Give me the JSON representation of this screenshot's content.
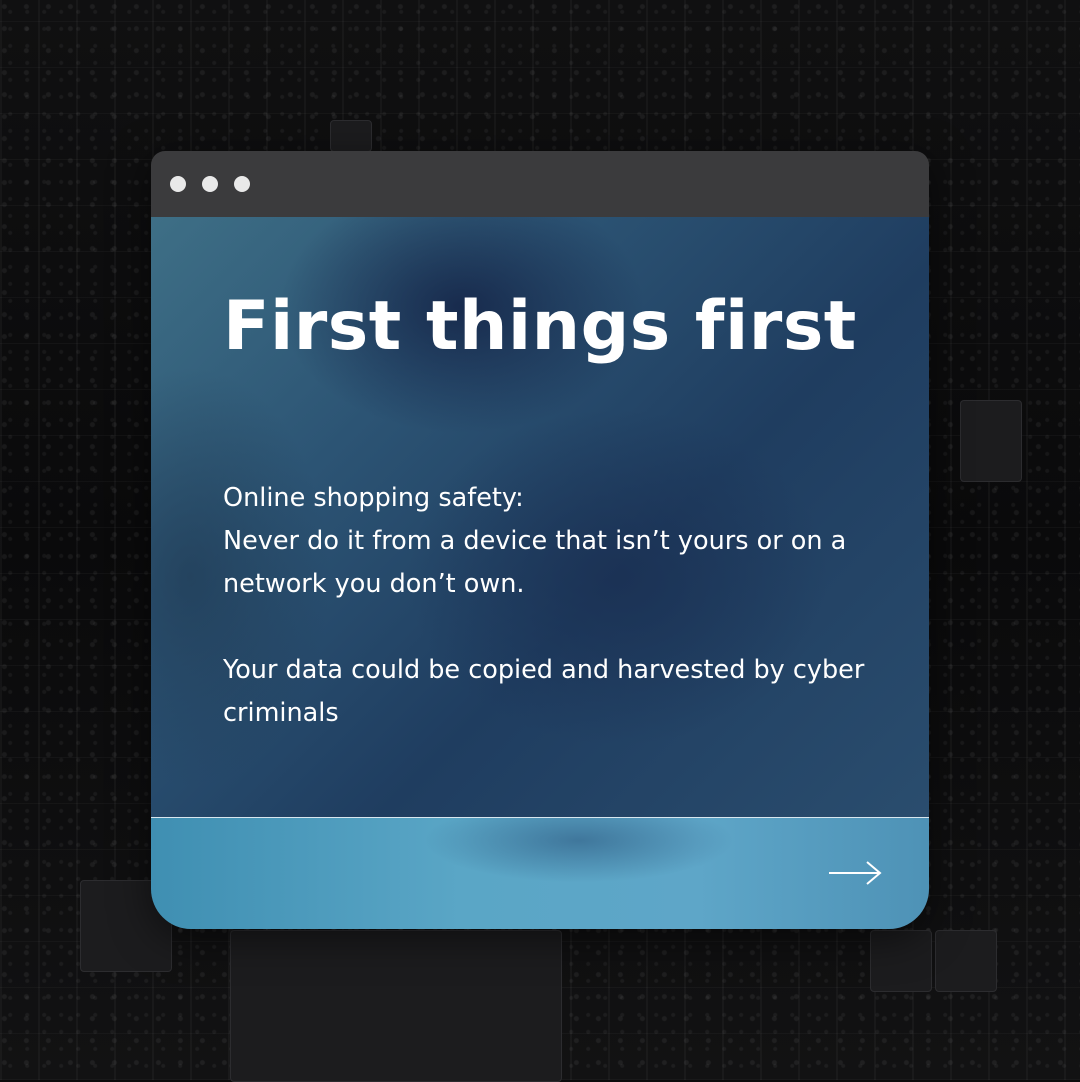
{
  "card": {
    "title": "First things first",
    "lines": [
      "Online shopping safety:",
      "Never do it from a device that isn’t yours or on a",
      "network you don’t own."
    ],
    "lines2": [
      "Your data could be copied and harvested by cyber",
      "criminals"
    ]
  },
  "icons": {
    "window_dots": [
      "window-dot-icon",
      "window-dot-icon",
      "window-dot-icon"
    ],
    "next": "arrow-right-icon"
  },
  "colors": {
    "titlebar": "#3b3b3d",
    "panel": "#2c5474",
    "footer": "#5aa6c6",
    "text": "#ffffff"
  }
}
